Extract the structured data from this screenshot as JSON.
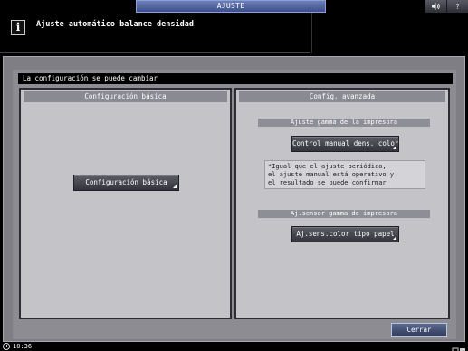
{
  "topbar": {
    "tab_label": "AJUSTE",
    "sound_icon": "speaker-icon",
    "help_label": "?"
  },
  "header": {
    "title": "Ajuste automático balance densidad",
    "info_glyph": "i"
  },
  "status_message": "La configuración se puede cambiar",
  "left_panel": {
    "title": "Configuración básica",
    "button_label": "Configuración básica"
  },
  "right_panel": {
    "title": "Config. avanzada",
    "gamma_section_title": "Ajuste gamma de la impresora",
    "gamma_button_label": "Control manual dens. color",
    "note_lines": [
      "*Igual que el ajuste periódico,",
      " el ajuste manual está operativo y",
      " el resultado se puede confirmar"
    ],
    "sensor_section_title": "Aj.sensor gamma de impresora",
    "sensor_button_label": "Aj.sens.color tipo papel"
  },
  "footer": {
    "close_label": "Cerrar",
    "clock": "10:36"
  }
}
